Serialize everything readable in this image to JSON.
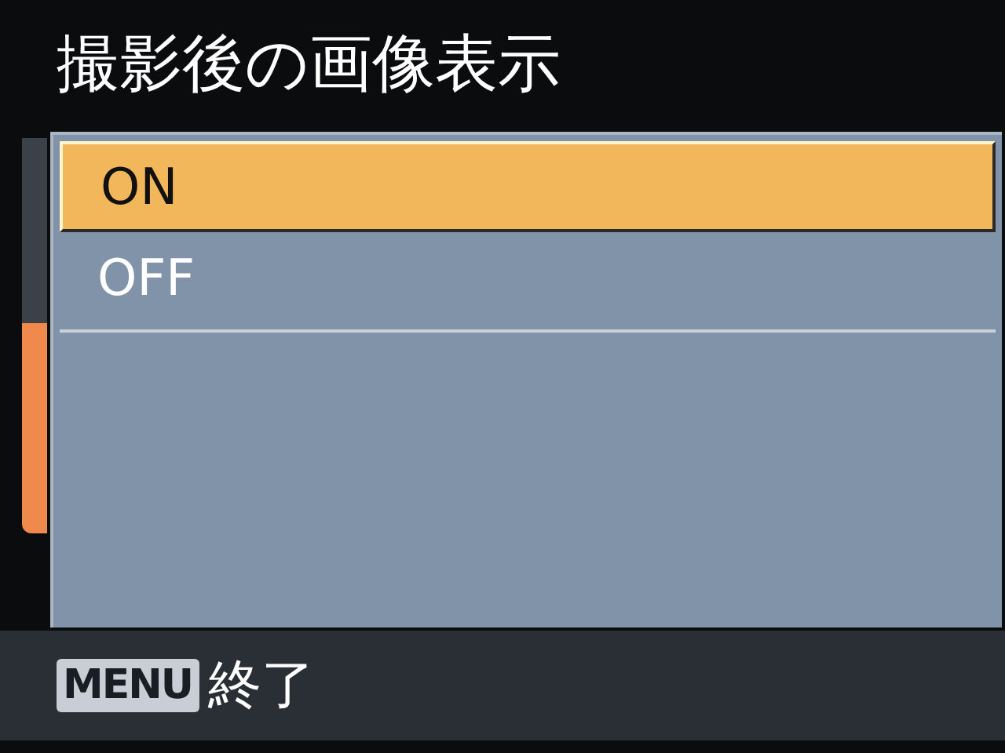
{
  "title": "撮影後の画像表示",
  "options": [
    {
      "label": "ON",
      "selected": true
    },
    {
      "label": "OFF",
      "selected": false
    }
  ],
  "footer": {
    "key": "MENU",
    "action": "終了"
  }
}
